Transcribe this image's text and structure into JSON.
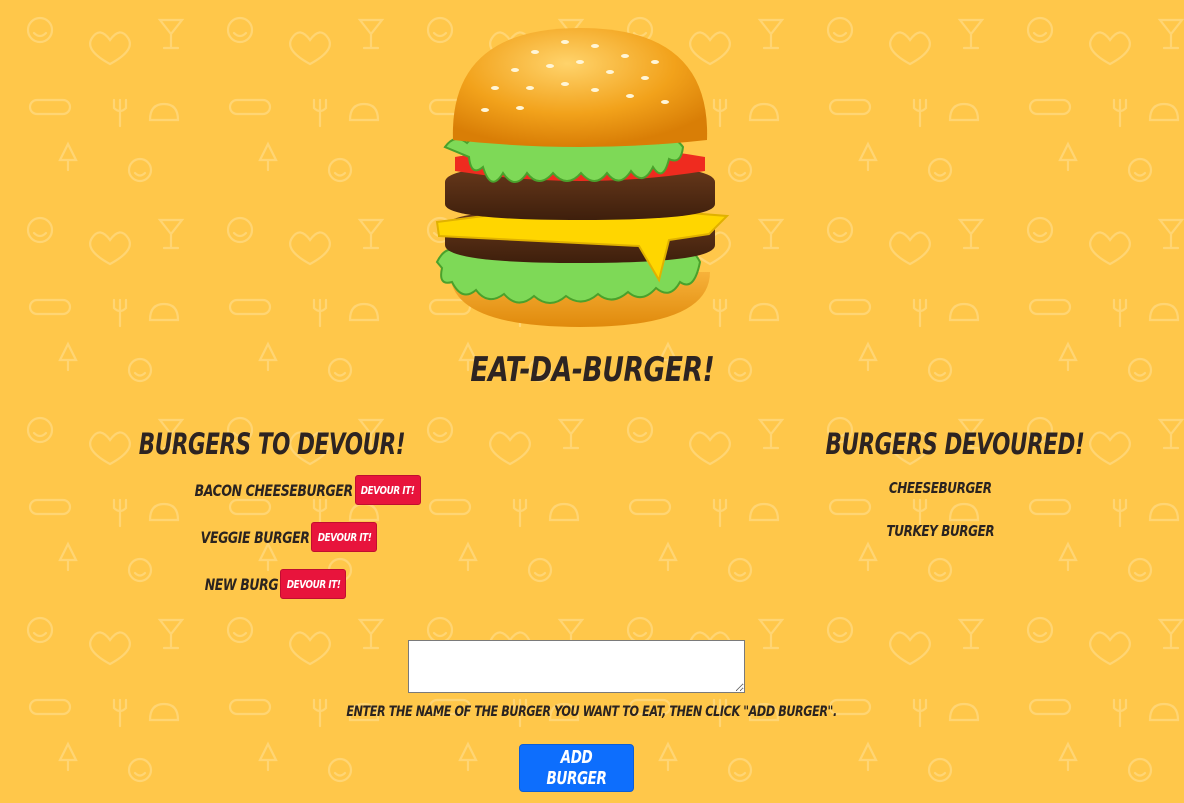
{
  "app": {
    "title": "Eat-Da-Burger!"
  },
  "to_devour": {
    "heading": "Burgers To Devour!",
    "button_label": "Devour It!",
    "items": [
      {
        "name": "Bacon Cheeseburger"
      },
      {
        "name": "Veggie Burger"
      },
      {
        "name": "New Burg"
      }
    ]
  },
  "devoured": {
    "heading": "Burgers Devoured!",
    "items": [
      {
        "name": "Cheeseburger"
      },
      {
        "name": "Turkey Burger"
      }
    ]
  },
  "form": {
    "input_value": "",
    "hint": "Enter the name of the burger you want to eat, then click \"Add Burger\".",
    "submit_label": "Add Burger"
  },
  "theme": {
    "background": "#ffc74a",
    "devour_button": "#e8143c",
    "add_button": "#0d6efd"
  },
  "icons": [
    "hamburger-icon",
    "food-doodle-pattern"
  ]
}
